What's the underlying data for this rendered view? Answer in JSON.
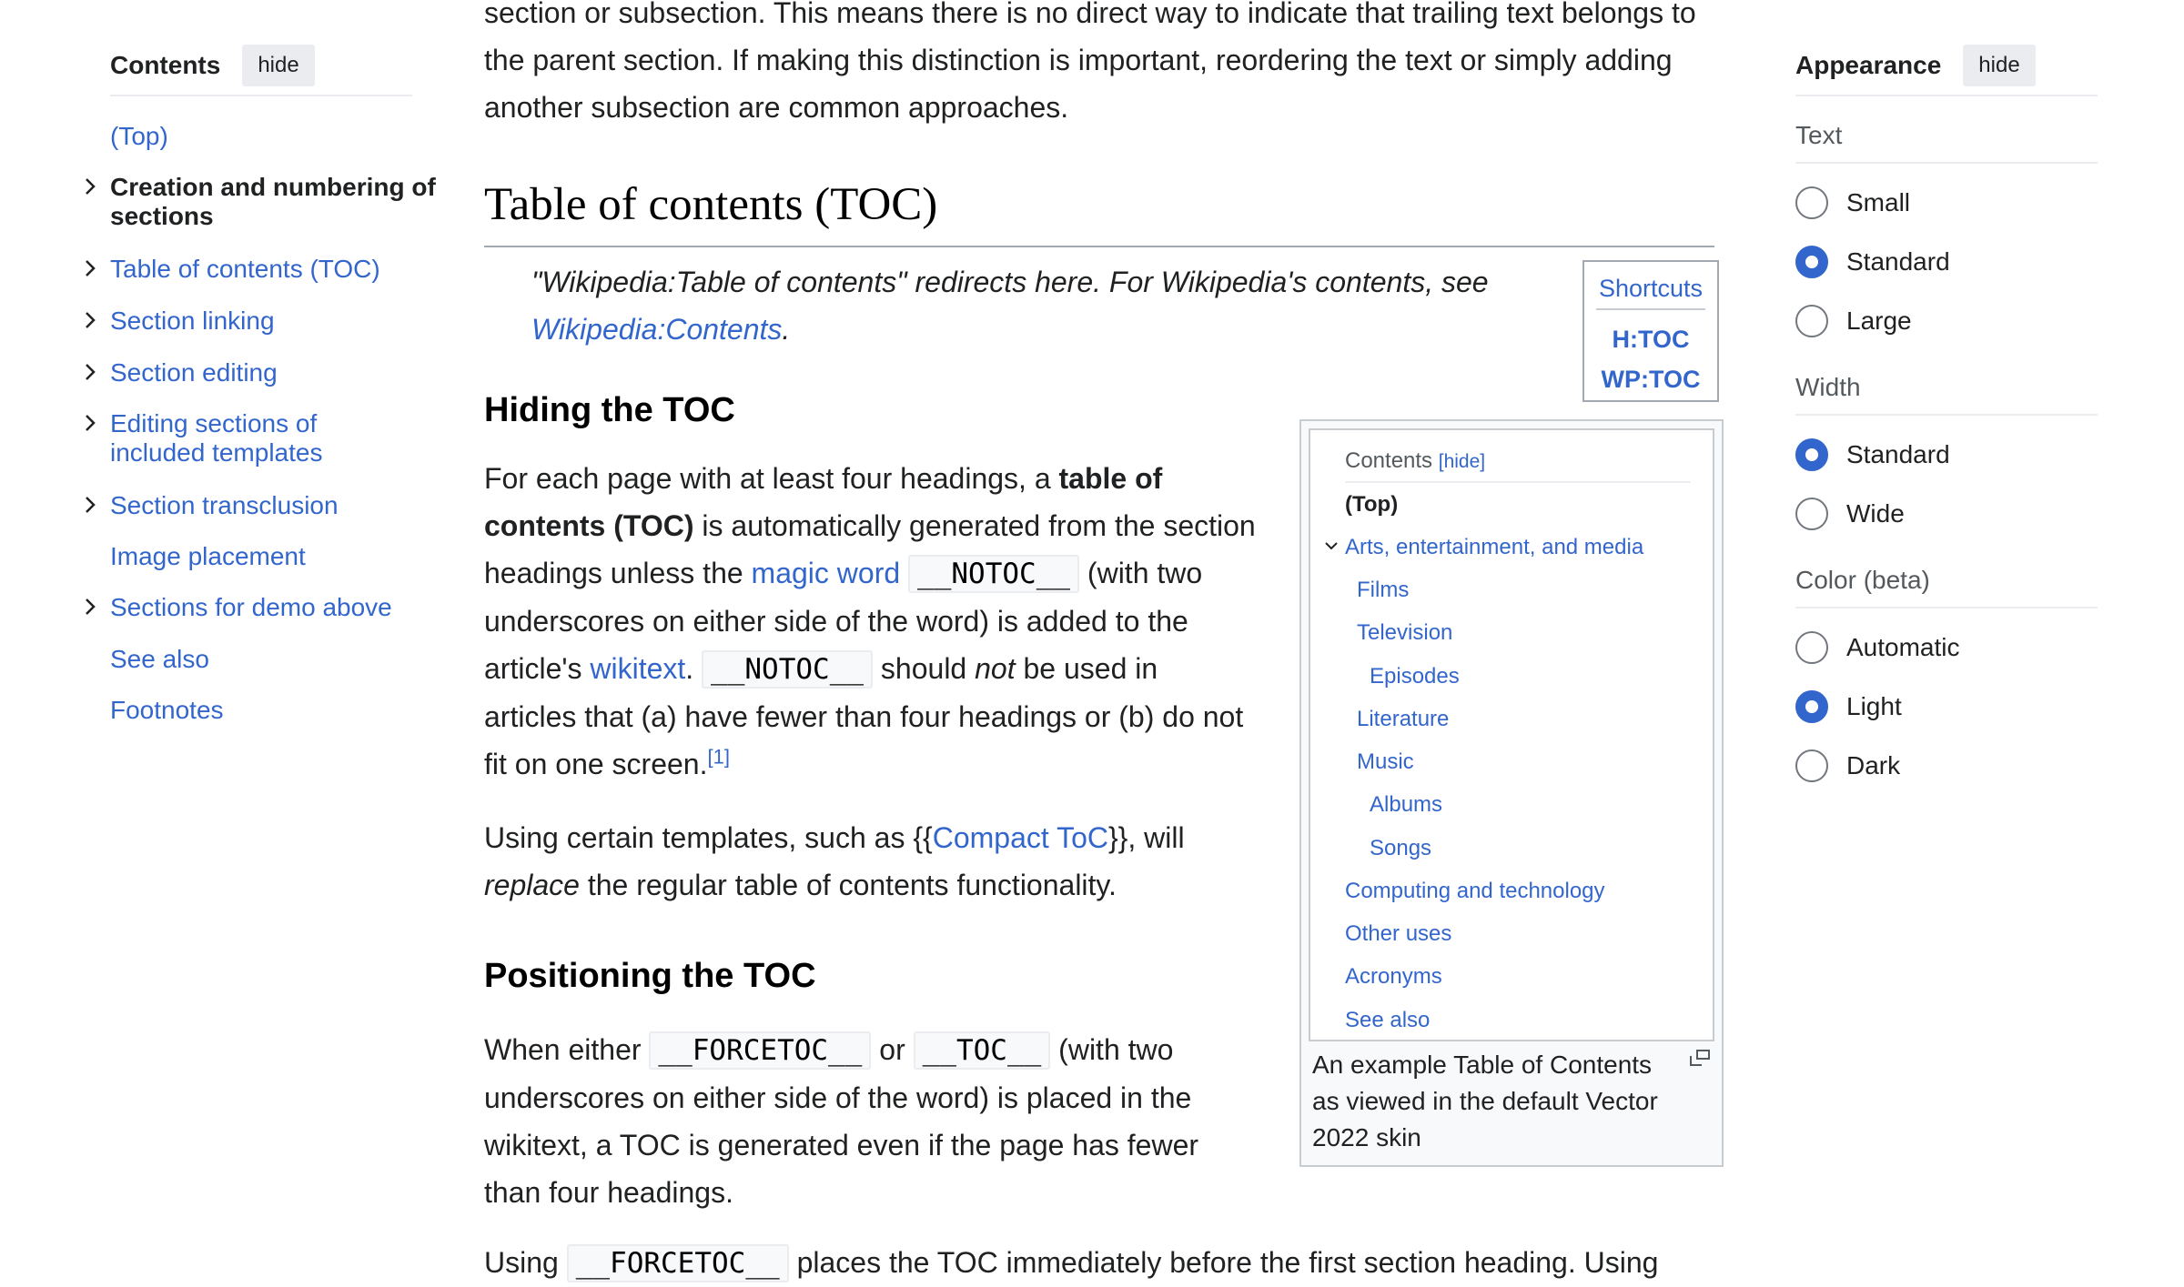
{
  "toc": {
    "title": "Contents",
    "hide_label": "hide",
    "items": [
      {
        "label": "(Top)"
      },
      {
        "label": "Creation and numbering of sections"
      },
      {
        "label": "Table of contents (TOC)"
      },
      {
        "label": "Section linking"
      },
      {
        "label": "Section editing"
      },
      {
        "label": "Editing sections of included templates"
      },
      {
        "label": "Section transclusion"
      },
      {
        "label": "Image placement"
      },
      {
        "label": "Sections for demo above"
      },
      {
        "label": "See also"
      },
      {
        "label": "Footnotes"
      }
    ]
  },
  "main": {
    "intro_line1": "section or subsection. This means there is no direct way to indicate that trailing text belongs to",
    "intro_line2": "the parent section. If making this distinction is important, reordering the text or simply adding",
    "intro_line3": "another subsection are common approaches.",
    "h2": "Table of contents (TOC)",
    "hatnote_text": "\"Wikipedia:Table of contents\" redirects here. For Wikipedia's contents, see",
    "hatnote_link": "Wikipedia:Contents",
    "hatnote_end": ".",
    "shortcuts": {
      "title": "Shortcuts",
      "links": [
        "H:TOC",
        "WP:TOC"
      ]
    },
    "h3_hiding": "Hiding the TOC",
    "p1": {
      "a": "For each page with at least four headings, a ",
      "b_bold": "table of contents (TOC)",
      "c": " is automatically generated from the section headings unless the ",
      "d_link": "magic word",
      "e_code": "__NOTOC__",
      "f": " (with two underscores on either side of the word) is added to the article's ",
      "g_link": "wikitext",
      "h": ". ",
      "i_code": "__NOTOC__",
      "j": " should ",
      "k_italic": "not",
      "l": " be used in articles that (a) have fewer than four headings or (b) do not fit on one screen.",
      "m_ref": "[1]"
    },
    "p2": {
      "a": "Using certain templates, such as {{",
      "b_link": "Compact ToC",
      "c": "}}, will ",
      "d_italic": "replace",
      "e": " the regular table of contents functionality."
    },
    "h3_positioning": "Positioning the TOC",
    "p3": {
      "a": "When either ",
      "b_code": "__FORCETOC__",
      "c": " or ",
      "d_code": "__TOC__",
      "e": " (with two underscores on either side of the word) is placed in the wikitext, a TOC is generated even if the page has fewer than four headings."
    },
    "p4": {
      "a": "Using ",
      "b_code": "__FORCETOC__",
      "c": " places the TOC immediately before the first section heading. Using"
    },
    "figure": {
      "toc_title": "Contents",
      "toc_hide": "[hide]",
      "items": [
        {
          "label": "(Top)"
        },
        {
          "label": "Arts, entertainment, and media"
        },
        {
          "label": "Films"
        },
        {
          "label": "Television"
        },
        {
          "label": "Episodes"
        },
        {
          "label": "Literature"
        },
        {
          "label": "Music"
        },
        {
          "label": "Albums"
        },
        {
          "label": "Songs"
        },
        {
          "label": "Computing and technology"
        },
        {
          "label": "Other uses"
        },
        {
          "label": "Acronyms"
        },
        {
          "label": "See also"
        }
      ],
      "caption": "An example Table of Contents as viewed in the default Vector 2022 skin"
    }
  },
  "appearance": {
    "title": "Appearance",
    "hide_label": "hide",
    "text_label": "Text",
    "text_options": [
      "Small",
      "Standard",
      "Large"
    ],
    "text_selected": "Standard",
    "width_label": "Width",
    "width_options": [
      "Standard",
      "Wide"
    ],
    "width_selected": "Standard",
    "color_label": "Color (beta)",
    "color_options": [
      "Automatic",
      "Light",
      "Dark"
    ],
    "color_selected": "Light"
  }
}
